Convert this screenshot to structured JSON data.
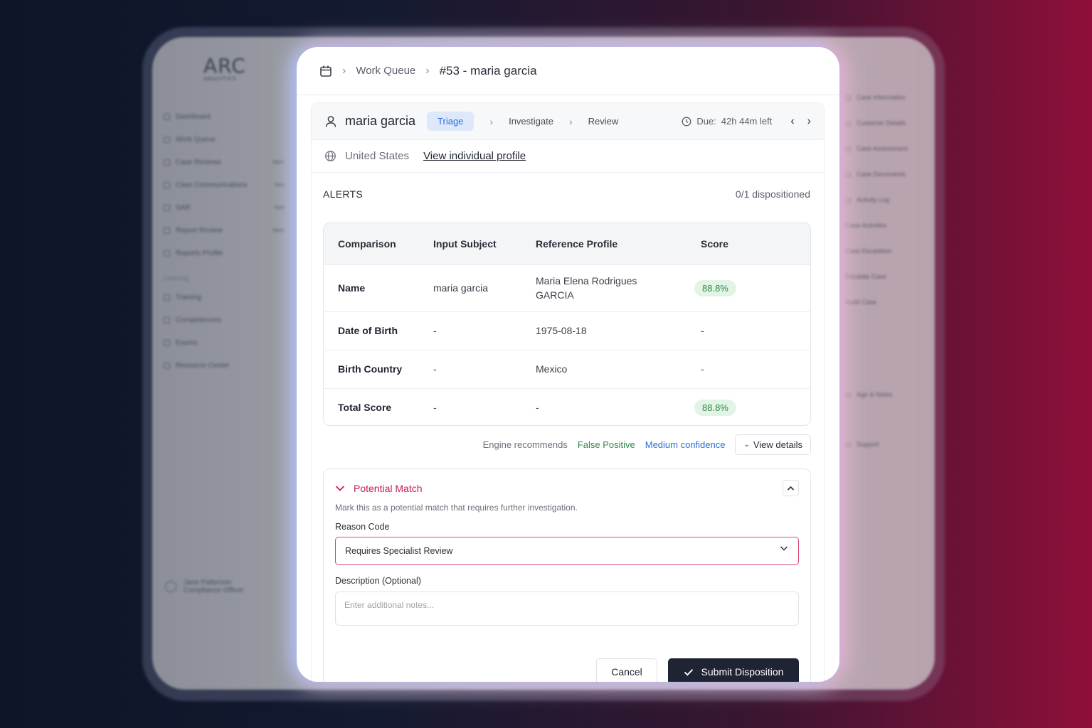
{
  "background_app": {
    "logo": "ARC",
    "logo_sub": "ANALYTICS",
    "nav": [
      {
        "label": "Dashboard",
        "count": ""
      },
      {
        "label": "Work Queue",
        "count": ""
      },
      {
        "label": "Case Reviews",
        "count": "Open"
      },
      {
        "label": "Case Communications",
        "count": "New"
      },
      {
        "label": "SAR",
        "count": "New"
      },
      {
        "label": "Report Review",
        "count": "Open"
      },
      {
        "label": "Reports Profile",
        "count": ""
      }
    ],
    "learning_section": "Learning",
    "learning_items": [
      "Training",
      "Competencies",
      "Exams",
      "Resource Center"
    ],
    "user_name": "Jane Patterson",
    "user_role": "Compliance Officer",
    "right_items": [
      "Case Information",
      "Customer Details",
      "Case Assessment",
      "Case Documents",
      "Activity Log",
      "Case Activities",
      "Case Escalation",
      "Escalate Case",
      "Audit Case",
      "Age & Notes",
      "Support"
    ]
  },
  "breadcrumb": {
    "queue": "Work Queue",
    "case": "#53 - maria garcia"
  },
  "case": {
    "name": "maria garcia",
    "steps": [
      "Triage",
      "Investigate",
      "Review"
    ],
    "due_label": "Due:",
    "due_value": "42h 44m left",
    "country": "United States",
    "profile_link": "View individual profile"
  },
  "alerts": {
    "title": "ALERTS",
    "count": "0/1 dispositioned",
    "columns": [
      "Comparison",
      "Input Subject",
      "Reference Profile",
      "Score"
    ],
    "rows": [
      {
        "comparison": "Name",
        "input": "maria garcia",
        "reference": "Maria Elena Rodrigues GARCIA",
        "score": "88.8%"
      },
      {
        "comparison": "Date of Birth",
        "input": "-",
        "reference": "1975-08-18",
        "score": "-"
      },
      {
        "comparison": "Birth Country",
        "input": "-",
        "reference": "Mexico",
        "score": "-"
      },
      {
        "comparison": "Total Score",
        "input": "-",
        "reference": "-",
        "score": "88.8%"
      }
    ]
  },
  "recommendation": {
    "label": "Engine recommends",
    "result": "False Positive",
    "confidence": "Medium confidence",
    "details_button": "View details"
  },
  "disposition": {
    "title": "Potential Match",
    "description": "Mark this as a potential match that requires further investigation.",
    "reason_label": "Reason Code",
    "reason_value": "Requires Specialist Review",
    "notes_label": "Description (Optional)",
    "notes_placeholder": "Enter additional notes...",
    "cancel": "Cancel",
    "submit": "Submit Disposition"
  },
  "colors": {
    "accent": "#c8195a",
    "primary_dark": "#1e2433",
    "success": "#2e8a45",
    "info": "#2d6fd6"
  }
}
